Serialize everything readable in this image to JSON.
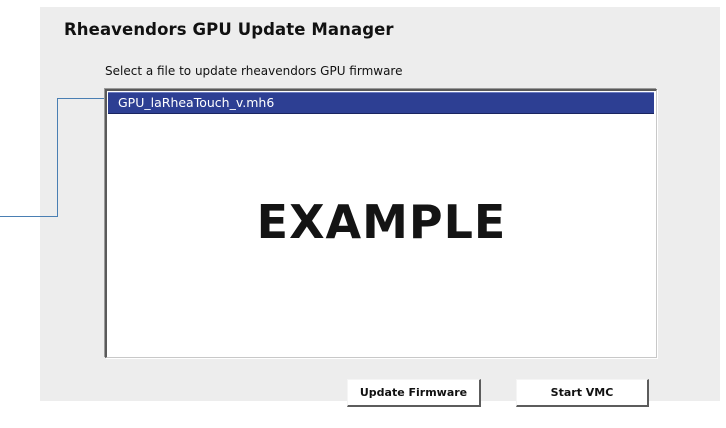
{
  "window": {
    "title": "Rheavendors GPU Update Manager",
    "subtitle": "Select a file to update rheavendors GPU firmware"
  },
  "file_list": {
    "items": [
      {
        "label": "GPU_laRheaTouch_v.mh6",
        "selected": true
      }
    ],
    "selection_color": "#2d3f93"
  },
  "overlay": {
    "watermark": "EXAMPLE"
  },
  "actions": {
    "update_label": "Update Firmware",
    "start_label": "Start VMC"
  },
  "colors": {
    "panel_background": "#ededed",
    "callout_line": "#4a7fb3"
  }
}
